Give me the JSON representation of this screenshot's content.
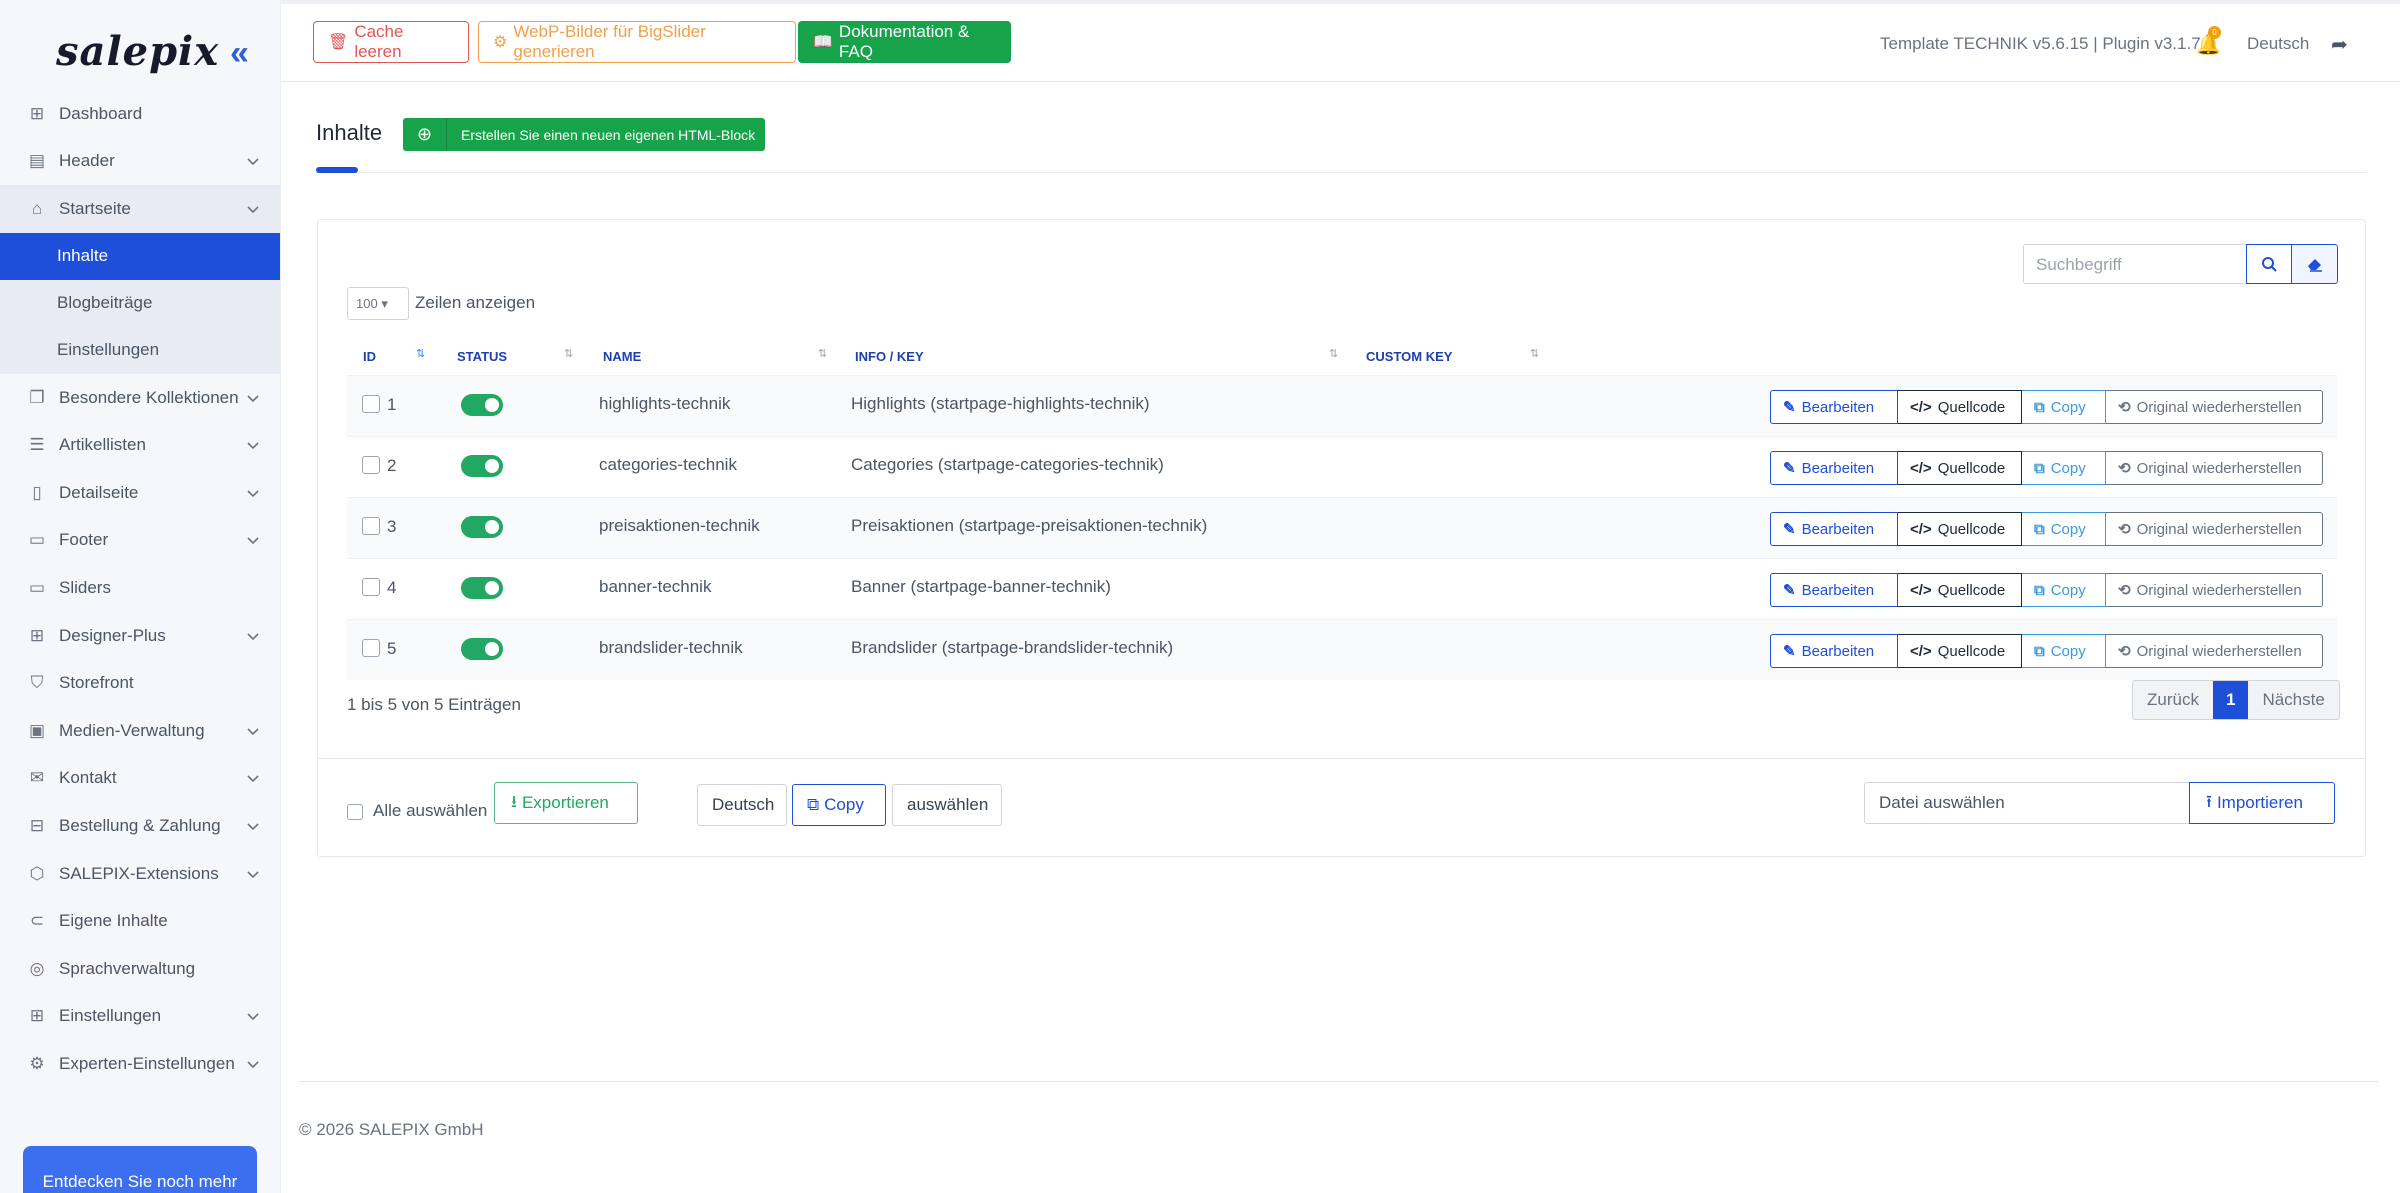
{
  "sidebar": {
    "logo": "salepix",
    "items": [
      {
        "label": "Dashboard",
        "icon": "grid-icon",
        "chev": false
      },
      {
        "label": "Header",
        "icon": "header-icon",
        "chev": true
      },
      {
        "label": "Startseite",
        "icon": "home-icon",
        "chev": true,
        "open": true
      },
      {
        "label": "Besondere Kollektionen",
        "icon": "collection-icon",
        "chev": true
      },
      {
        "label": "Artikellisten",
        "icon": "list-icon",
        "chev": true
      },
      {
        "label": "Detailseite",
        "icon": "tablet-icon",
        "chev": true
      },
      {
        "label": "Footer",
        "icon": "footer-icon",
        "chev": true
      },
      {
        "label": "Sliders",
        "icon": "slider-icon",
        "chev": false
      },
      {
        "label": "Designer-Plus",
        "icon": "layout-icon",
        "chev": true
      },
      {
        "label": "Storefront",
        "icon": "store-icon",
        "chev": false
      },
      {
        "label": "Medien-Verwaltung",
        "icon": "image-icon",
        "chev": true
      },
      {
        "label": "Kontakt",
        "icon": "mail-icon",
        "chev": true
      },
      {
        "label": "Bestellung & Zahlung",
        "icon": "basket-icon",
        "chev": true
      },
      {
        "label": "SALEPIX-Extensions",
        "icon": "box-icon",
        "chev": true
      },
      {
        "label": "Eigene Inhalte",
        "icon": "tag-icon",
        "chev": false
      },
      {
        "label": "Sprachverwaltung",
        "icon": "globe-icon",
        "chev": false
      },
      {
        "label": "Einstellungen",
        "icon": "grid-icon",
        "chev": true
      },
      {
        "label": "Experten-Einstellungen",
        "icon": "gear-icon",
        "chev": true
      }
    ],
    "subitems": [
      "Inhalte",
      "Blogbeiträge",
      "Einstellungen"
    ],
    "promo": "Entdecken Sie noch mehr"
  },
  "topbar": {
    "cache": "Cache leeren",
    "webp": "WebP-Bilder für BigSlider generieren",
    "docs": "Dokumentation & FAQ",
    "version": "Template TECHNIK v5.6.15 | Plugin v3.1.7",
    "notif_count": "0",
    "language": "Deutsch"
  },
  "page": {
    "title": "Inhalte",
    "create": "Erstellen Sie einen neuen eigenen HTML-Block"
  },
  "table": {
    "search_placeholder": "Suchbegriff",
    "length": "100",
    "length_label": "Zeilen anzeigen",
    "headers": [
      "ID",
      "STATUS",
      "NAME",
      "INFO / KEY",
      "CUSTOM KEY"
    ],
    "rows": [
      {
        "id": "1",
        "name": "highlights-technik",
        "info": "Highlights (startpage-highlights-technik)"
      },
      {
        "id": "2",
        "name": "categories-technik",
        "info": "Categories (startpage-categories-technik)"
      },
      {
        "id": "3",
        "name": "preisaktionen-technik",
        "info": "Preisaktionen (startpage-preisaktionen-technik)"
      },
      {
        "id": "4",
        "name": "banner-technik",
        "info": "Banner (startpage-banner-technik)"
      },
      {
        "id": "5",
        "name": "brandslider-technik",
        "info": "Brandslider (startpage-brandslider-technik)"
      }
    ],
    "actions": {
      "edit": "Bearbeiten",
      "source": "Quellcode",
      "copy": "Copy",
      "restore": "Original wiederherstellen"
    },
    "info": "1 bis 5 von 5 Einträgen",
    "pager": {
      "prev": "Zurück",
      "current": "1",
      "next": "Nächste"
    }
  },
  "footer_bar": {
    "select_all": "Alle auswählen",
    "export": "Exportieren",
    "lang": "Deutsch",
    "copy": "Copy",
    "select": "auswählen",
    "file": "Datei auswählen",
    "import": "Importieren"
  },
  "copyright": "© 2026 SALEPIX GmbH"
}
